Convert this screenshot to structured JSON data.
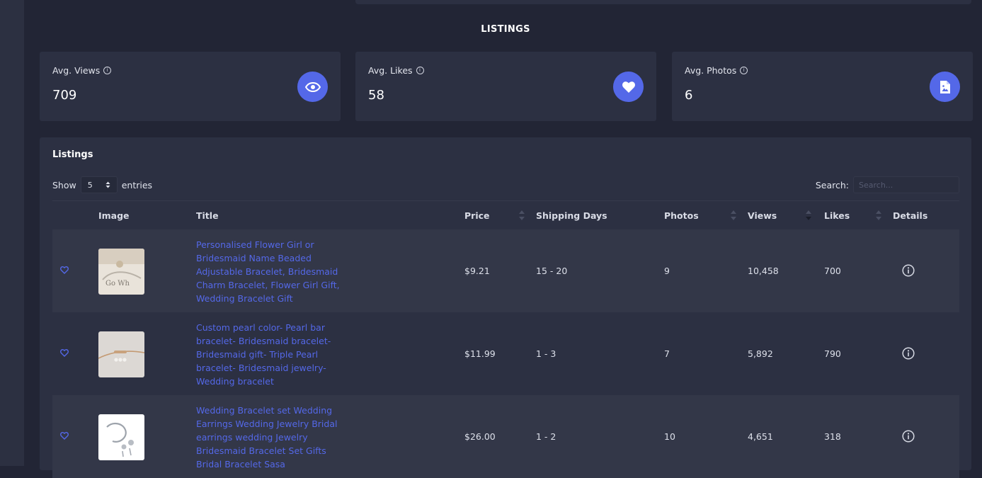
{
  "page": {
    "section_title": "LISTINGS"
  },
  "stats": [
    {
      "label": "Avg. Views",
      "value": "709",
      "icon": "eye-icon"
    },
    {
      "label": "Avg. Likes",
      "value": "58",
      "icon": "heart-icon"
    },
    {
      "label": "Avg. Photos",
      "value": "6",
      "icon": "image-file-icon"
    }
  ],
  "listings": {
    "heading": "Listings",
    "show_label": "Show",
    "entries_value": "5",
    "entries_label": "entries",
    "search_label": "Search:",
    "search_placeholder": "Search...",
    "columns": {
      "image": "Image",
      "title": "Title",
      "price": "Price",
      "shipping": "Shipping Days",
      "photos": "Photos",
      "views": "Views",
      "likes": "Likes",
      "details": "Details"
    },
    "rows": [
      {
        "title": "Personalised Flower Girl or Bridesmaid Name Beaded Adjustable Bracelet, Bridesmaid Charm Bracelet, Flower Girl Gift, Wedding Bracelet Gift",
        "price": "$9.21",
        "shipping": "15 - 20",
        "photos": "9",
        "views": "10,458",
        "likes": "700"
      },
      {
        "title": "Custom pearl color- Pearl bar bracelet- Bridesmaid bracelet- Bridesmaid gift- Triple Pearl bracelet- Bridesmaid jewelry- Wedding bracelet",
        "price": "$11.99",
        "shipping": "1 - 3",
        "photos": "7",
        "views": "5,892",
        "likes": "790"
      },
      {
        "title": "Wedding Bracelet set Wedding Earrings Wedding Jewelry Bridal earrings wedding Jewelry Bridesmaid Bracelet Set Gifts Bridal Bracelet Sasa",
        "price": "$26.00",
        "shipping": "1 - 2",
        "photos": "10",
        "views": "4,651",
        "likes": "318"
      }
    ]
  },
  "colors": {
    "accent": "#5468e8",
    "card": "#2c3042",
    "background": "#222535"
  }
}
